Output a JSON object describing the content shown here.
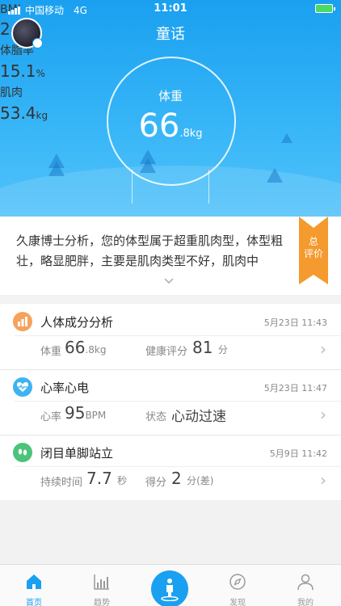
{
  "status": {
    "carrier": "中国移动",
    "network": "4G",
    "time": "11:01"
  },
  "header": {
    "title": "童话"
  },
  "weight": {
    "label": "体重",
    "value_int": "66",
    "value_frac": ".8kg"
  },
  "metrics": [
    {
      "label": "BMI",
      "value": "24.2",
      "unit": ""
    },
    {
      "label": "体脂率",
      "value": "15.1",
      "unit": "%"
    },
    {
      "label": "肌肉",
      "value": "53.4",
      "unit": "kg"
    }
  ],
  "analysis": {
    "text": "久康博士分析，您的体型属于超重肌肉型，体型粗壮，略显肥胖，主要是肌肉类型不好，肌肉中",
    "ribbon_line1": "总",
    "ribbon_line2": "评价"
  },
  "cards": [
    {
      "name": "人体成分分析",
      "date": "5月23日 11:43",
      "items": [
        {
          "label": "体重",
          "value": "66",
          "unit": ".8kg"
        },
        {
          "label": "健康评分",
          "value": "81",
          "unit": "分"
        }
      ]
    },
    {
      "name": "心率心电",
      "date": "5月23日 11:47",
      "items": [
        {
          "label": "心率",
          "value": "95",
          "unit": "BPM"
        },
        {
          "label": "状态",
          "value": "心动过速",
          "unit": ""
        }
      ]
    },
    {
      "name": "闭目单脚站立",
      "date": "5月9日 11:42",
      "items": [
        {
          "label": "持续时间",
          "value": "7.7",
          "unit": "秒"
        },
        {
          "label": "得分",
          "value": "2",
          "unit": "分(差)"
        }
      ]
    }
  ],
  "tabs": [
    {
      "label": "首页"
    },
    {
      "label": "趋势"
    },
    {
      "label": ""
    },
    {
      "label": "发现"
    },
    {
      "label": "我的"
    }
  ],
  "colors": {
    "primary": "#1aa0f0",
    "ribbon": "#f49a2e",
    "card1_icon": "#f5a35c",
    "card2_icon": "#3eb3f2",
    "card3_icon": "#4cc37a"
  }
}
